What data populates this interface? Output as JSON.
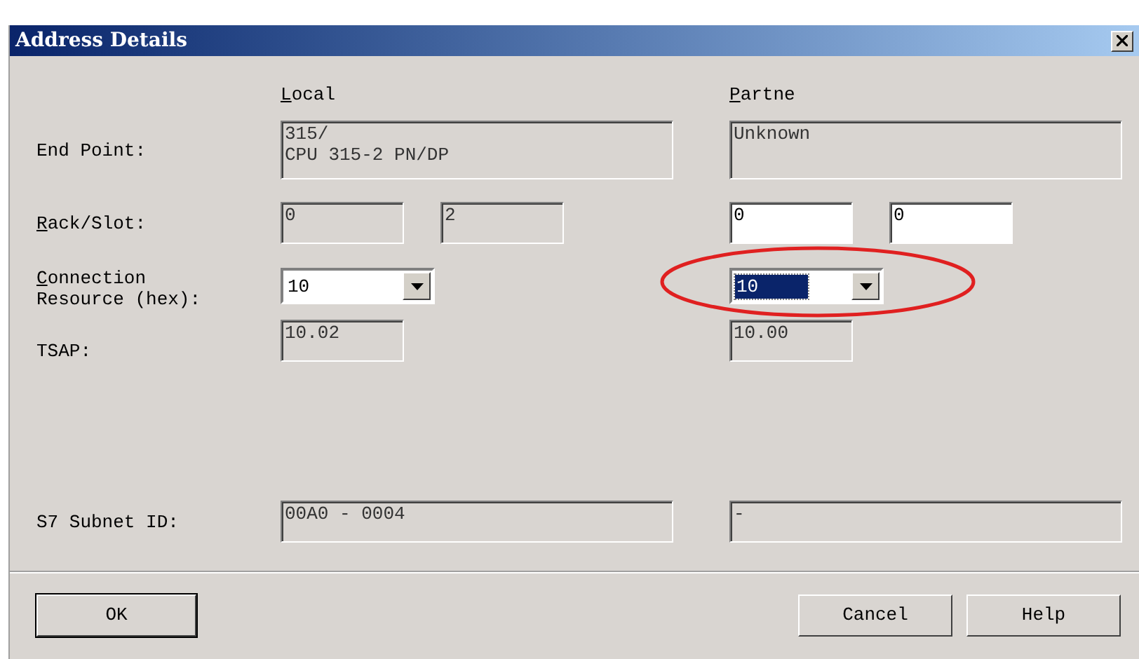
{
  "window": {
    "title": "Address Details"
  },
  "columns": [
    {
      "label": "Local",
      "underline_first": true
    },
    {
      "label": "Partne",
      "underline_first": true
    }
  ],
  "rows": [
    {
      "label": "End Point:",
      "underline_first": false,
      "local": [
        {
          "kind": "area",
          "value": "315/\nCPU 315-2 PN/DP",
          "disabled": true
        }
      ],
      "partner": [
        {
          "kind": "area",
          "value": "Unknown",
          "disabled": true
        }
      ]
    },
    {
      "label": "Rack/Slot:",
      "underline_first": true,
      "local": [
        {
          "kind": "edit",
          "value": "0",
          "disabled": true
        },
        {
          "kind": "edit",
          "value": "2",
          "disabled": true
        }
      ],
      "partner": [
        {
          "kind": "edit",
          "value": "0",
          "disabled": false
        },
        {
          "kind": "edit",
          "value": "0",
          "disabled": false
        }
      ]
    },
    {
      "label": "Connection\nResource (hex):",
      "underline_first": true,
      "local": [
        {
          "kind": "combo",
          "value": "10",
          "focused": false,
          "circled": false
        }
      ],
      "partner": [
        {
          "kind": "combo",
          "value": "10",
          "focused": true,
          "circled": true
        }
      ]
    },
    {
      "label": "TSAP:",
      "underline_first": false,
      "local": [
        {
          "kind": "edit",
          "value": "10.02",
          "disabled": true
        }
      ],
      "partner": [
        {
          "kind": "edit",
          "value": "10.00",
          "disabled": true
        }
      ]
    },
    {
      "label": "S7 Subnet ID:",
      "underline_first": false,
      "local": [
        {
          "kind": "line",
          "value": "00A0 - 0004",
          "disabled": true
        }
      ],
      "partner": [
        {
          "kind": "line",
          "value": "-",
          "disabled": true
        }
      ]
    }
  ],
  "buttons": [
    {
      "label": "OK",
      "default": true
    },
    {
      "label": "Cancel",
      "default": false
    },
    {
      "label": "Help",
      "default": false
    }
  ]
}
